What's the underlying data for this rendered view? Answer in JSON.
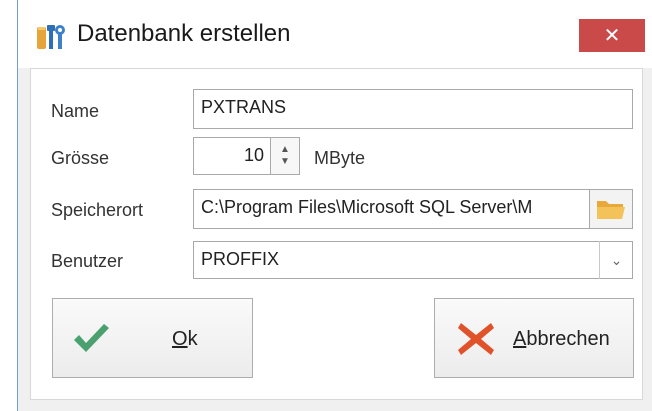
{
  "window": {
    "title": "Datenbank erstellen",
    "close_symbol": "✕",
    "accent_close": "#c94a48"
  },
  "form": {
    "name_label": "Name",
    "name_value": "PXTRANS",
    "size_label": "Grösse",
    "size_value": "10",
    "size_unit": "MByte",
    "location_label": "Speicherort",
    "location_value": "C:\\Program Files\\Microsoft SQL Server\\M",
    "user_label": "Benutzer",
    "user_value": "PROFFIX"
  },
  "buttons": {
    "ok": {
      "mnemonic": "O",
      "rest": "k",
      "icon": "check-icon",
      "color": "#4aa06e"
    },
    "cancel": {
      "mnemonic": "A",
      "rest": "bbrechen",
      "icon": "x-icon",
      "color": "#e0532a"
    }
  }
}
